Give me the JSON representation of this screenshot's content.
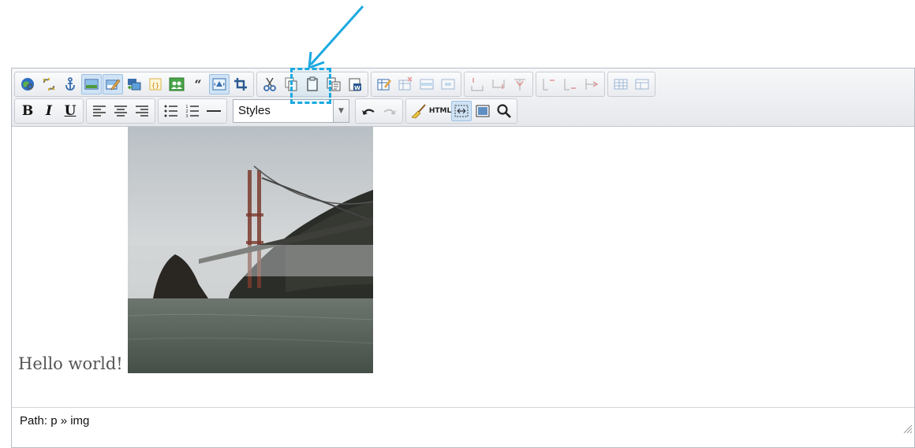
{
  "annotation": {
    "color": "#1ba9e1",
    "target": "image-align-icon"
  },
  "toolbar": {
    "row1": [
      {
        "group": "links",
        "icons": [
          "insert-link-icon",
          "unlink-icon",
          "anchor-icon",
          "insert-image-icon",
          "edit-image-icon",
          "insert-media-icon",
          "insert-code-icon",
          "gallery-icon",
          "blockquote-icon",
          "image-align-icon",
          "crop-icon"
        ]
      },
      {
        "group": "clipboard",
        "icons": [
          "cut-icon",
          "copy-icon",
          "paste-icon",
          "paste-text-icon",
          "paste-word-icon"
        ]
      },
      {
        "group": "table",
        "icons": [
          "table-properties-icon",
          "delete-table-icon",
          "row-properties-icon",
          "cell-properties-icon"
        ]
      },
      {
        "group": "rows",
        "icons": [
          "insert-row-before-icon",
          "insert-row-after-icon",
          "delete-row-icon"
        ]
      },
      {
        "group": "cols",
        "icons": [
          "insert-col-before-icon",
          "insert-col-after-icon",
          "delete-col-icon"
        ]
      },
      {
        "group": "merge",
        "icons": [
          "split-cells-icon",
          "merge-cells-icon"
        ]
      }
    ],
    "row2": {
      "bold": "B",
      "italic": "I",
      "underline": "U",
      "styles_value": "Styles",
      "html_label": "HTML"
    }
  },
  "content": {
    "text": "Hello world!"
  },
  "status": {
    "path": "Path: p » img"
  }
}
